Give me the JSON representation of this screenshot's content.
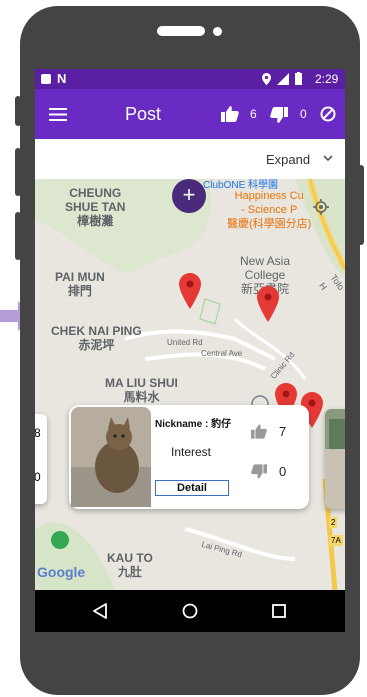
{
  "status_bar": {
    "time": "2:29"
  },
  "app_bar": {
    "title": "Post",
    "like_count": "6",
    "dislike_count": "0"
  },
  "expand_bar": {
    "expand_label": "Expand"
  },
  "map": {
    "places": {
      "cheung_shue_tan": "CHEUNG\nSHUE TAN\n樟樹灘",
      "pai_mun": "PAI MUN\n排門",
      "chek_nai_ping": "CHEK NAI PING\n赤泥坪",
      "ma_liu_shui": "MA LIU SHUI\n馬料水",
      "kau_to": "KAU TO\n九肚",
      "clubone": "ClubONE 科學園",
      "happiness_science": "Happiness Cu\n- Science P\n醫慶(科學園分店)",
      "new_asia": "New Asia\nCollege\n新亞書院",
      "united_rd": "United Rd",
      "central_ave": "Central Ave",
      "clinic_rd": "Clinic Rd",
      "lai_ping_rd": "Lai Ping Rd",
      "tolo_hwy": "Tolo H",
      "google": "Google"
    }
  },
  "card": {
    "nickname": "Nickname : 豹仔",
    "description": "Interest",
    "detail_label": "Detail",
    "likes": "7",
    "dislikes": "0"
  },
  "left_card": {
    "top_value": "8",
    "bottom_value": "0"
  },
  "colors": {
    "primary": "#6a2bc4",
    "status": "#5b1fa4",
    "pin": "#e53935",
    "fab": "#4a2a7a"
  }
}
